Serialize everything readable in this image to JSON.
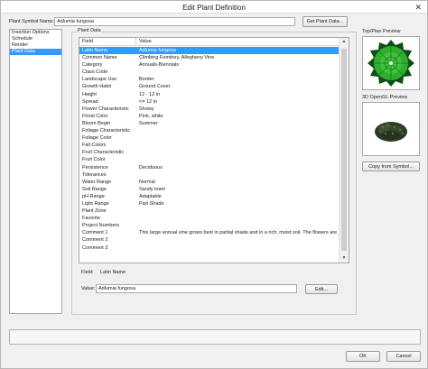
{
  "window": {
    "title": "Edit Plant Definition",
    "close_glyph": "✕"
  },
  "symbol": {
    "label": "Plant Symbol Name:",
    "value": "Adlumia fungosa",
    "get_button": "Get Plant Data..."
  },
  "left_nav": {
    "items": [
      {
        "label": "Insertion Options"
      },
      {
        "label": "Schedule"
      },
      {
        "label": "Render"
      },
      {
        "label": "Plant Data"
      }
    ],
    "selected": "Plant Data"
  },
  "plant_data": {
    "group_title": "Plant Data",
    "columns": {
      "field": "Field",
      "value": "Value"
    },
    "rows": [
      {
        "field": "Latin Name",
        "value": "Adlumia fungosa"
      },
      {
        "field": "Common Name",
        "value": "Climbing Fumitory, Allegheny Vine"
      },
      {
        "field": "Category",
        "value": "Annuals-Biennials"
      },
      {
        "field": "Class Code",
        "value": ""
      },
      {
        "field": "Landscape Use",
        "value": "Border"
      },
      {
        "field": "Growth Habit",
        "value": "Ground Cover"
      },
      {
        "field": "Height",
        "value": "12 - 12 in"
      },
      {
        "field": "Spread",
        "value": "<= 12 in"
      },
      {
        "field": "Flower Characteristic",
        "value": "Showy"
      },
      {
        "field": "Floral Color",
        "value": "Pink, white"
      },
      {
        "field": "Bloom Begin",
        "value": "Summer"
      },
      {
        "field": "Foliage Characteristic",
        "value": ""
      },
      {
        "field": "Foliage Color",
        "value": ""
      },
      {
        "field": "Fall Colors",
        "value": ""
      },
      {
        "field": "Fruit Characteristic",
        "value": ""
      },
      {
        "field": "Fruit Color",
        "value": ""
      },
      {
        "field": "Persistence",
        "value": "Deciduous"
      },
      {
        "field": "Tolerances",
        "value": ""
      },
      {
        "field": "Water Range",
        "value": "Normal"
      },
      {
        "field": "Soil Range",
        "value": "Sandy loam"
      },
      {
        "field": "pH Range",
        "value": "Adaptable"
      },
      {
        "field": "Light Range",
        "value": "Part Shade"
      },
      {
        "field": "Plant Zone",
        "value": ""
      },
      {
        "field": "Favorite",
        "value": ""
      },
      {
        "field": "Project Numbers",
        "value": ""
      },
      {
        "field": "Comment 1",
        "value": "This large annual vine grows best in partial shade and in a rich, moist soil. The flowers are borne"
      },
      {
        "field": "Comment 2",
        "value": ""
      },
      {
        "field": "Comment 3",
        "value": ""
      }
    ],
    "selected_field": "Latin Name",
    "field_label": "Field:",
    "field_value": "Latin Name",
    "value_label": "Value:",
    "value_input": "Adlumia fungosa",
    "edit_button": "Edit..."
  },
  "preview": {
    "top_title": "Top/Plan Preview",
    "opengl_title": "3D OpenGL Preview",
    "copy_button": "Copy from Symbol..."
  },
  "footer": {
    "ok": "OK",
    "cancel": "Cancel"
  },
  "colors": {
    "selection": "#3399ff",
    "plant_green": "#2fae2f",
    "plant_dark": "#0d4f12"
  }
}
